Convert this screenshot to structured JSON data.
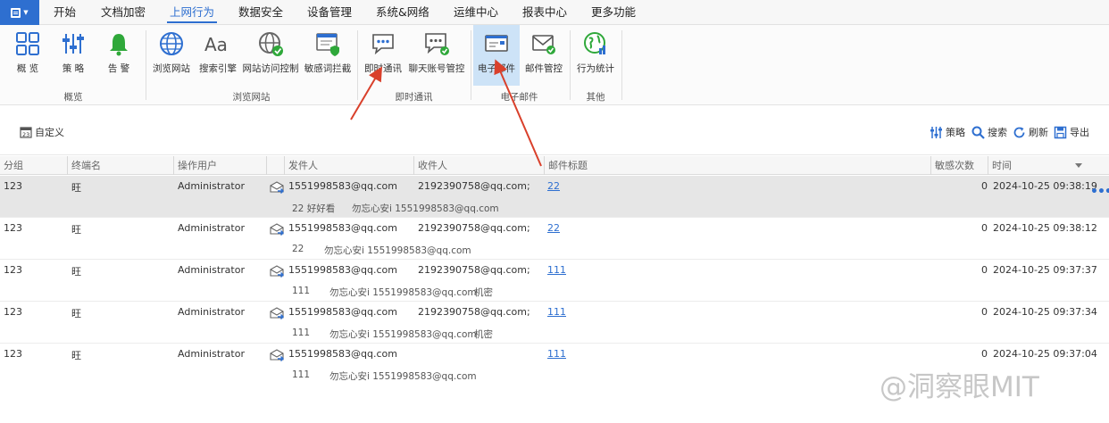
{
  "menu": {
    "tabs": [
      "开始",
      "文档加密",
      "上网行为",
      "数据安全",
      "设备管理",
      "系统&网络",
      "运维中心",
      "报表中心",
      "更多功能"
    ],
    "active": "上网行为"
  },
  "ribbon": {
    "buttons": [
      "概 览",
      "策 略",
      "告 警",
      "浏览网站",
      "搜索引擎",
      "网站访问控制",
      "敏感词拦截",
      "即时通讯",
      "聊天账号管控",
      "电子邮件",
      "邮件管控",
      "行为统计"
    ],
    "selected": "电子邮件",
    "groups": [
      "概览",
      "浏览网站",
      "即时通讯",
      "电子邮件",
      "其他"
    ]
  },
  "toolbar": {
    "custom": "自定义",
    "strategy": "策略",
    "search": "搜索",
    "refresh": "刷新",
    "export": "导出"
  },
  "table": {
    "headers": [
      "分组",
      "终端名",
      "操作用户",
      "发件人",
      "收件人",
      "邮件标题",
      "敏感次数",
      "时间"
    ],
    "rows": [
      {
        "group": "123",
        "terminal": "旺",
        "user": "Administrator",
        "sender": "1551998583@qq.com",
        "recipient": "2192390758@qq.com;",
        "subject": "22",
        "count": "0",
        "time": "2024-10-25 09:38:19",
        "preview_title": "22 好好看",
        "preview_from": "勿忘心安i 1551998583@qq.com",
        "preview_extra": ""
      },
      {
        "group": "123",
        "terminal": "旺",
        "user": "Administrator",
        "sender": "1551998583@qq.com",
        "recipient": "2192390758@qq.com;",
        "subject": "22",
        "count": "0",
        "time": "2024-10-25 09:38:12",
        "preview_title": "22",
        "preview_from": "勿忘心安i 1551998583@qq.com",
        "preview_extra": ""
      },
      {
        "group": "123",
        "terminal": "旺",
        "user": "Administrator",
        "sender": "1551998583@qq.com",
        "recipient": "2192390758@qq.com;",
        "subject": "111",
        "count": "0",
        "time": "2024-10-25 09:37:37",
        "preview_title": "111",
        "preview_from": "勿忘心安i 1551998583@qq.com",
        "preview_extra": "机密"
      },
      {
        "group": "123",
        "terminal": "旺",
        "user": "Administrator",
        "sender": "1551998583@qq.com",
        "recipient": "2192390758@qq.com;",
        "subject": "111",
        "count": "0",
        "time": "2024-10-25 09:37:34",
        "preview_title": "111",
        "preview_from": "勿忘心安i 1551998583@qq.com",
        "preview_extra": "机密"
      },
      {
        "group": "123",
        "terminal": "旺",
        "user": "Administrator",
        "sender": "1551998583@qq.com",
        "recipient": "",
        "subject": "111",
        "count": "0",
        "time": "2024-10-25 09:37:04",
        "preview_title": "111",
        "preview_from": "勿忘心安i 1551998583@qq.com",
        "preview_extra": ""
      }
    ]
  },
  "watermark": "@洞察眼MIT",
  "colors": {
    "accent": "#2e6fd0",
    "selected_button": "#cde3f7",
    "arrow": "#d9402b"
  }
}
